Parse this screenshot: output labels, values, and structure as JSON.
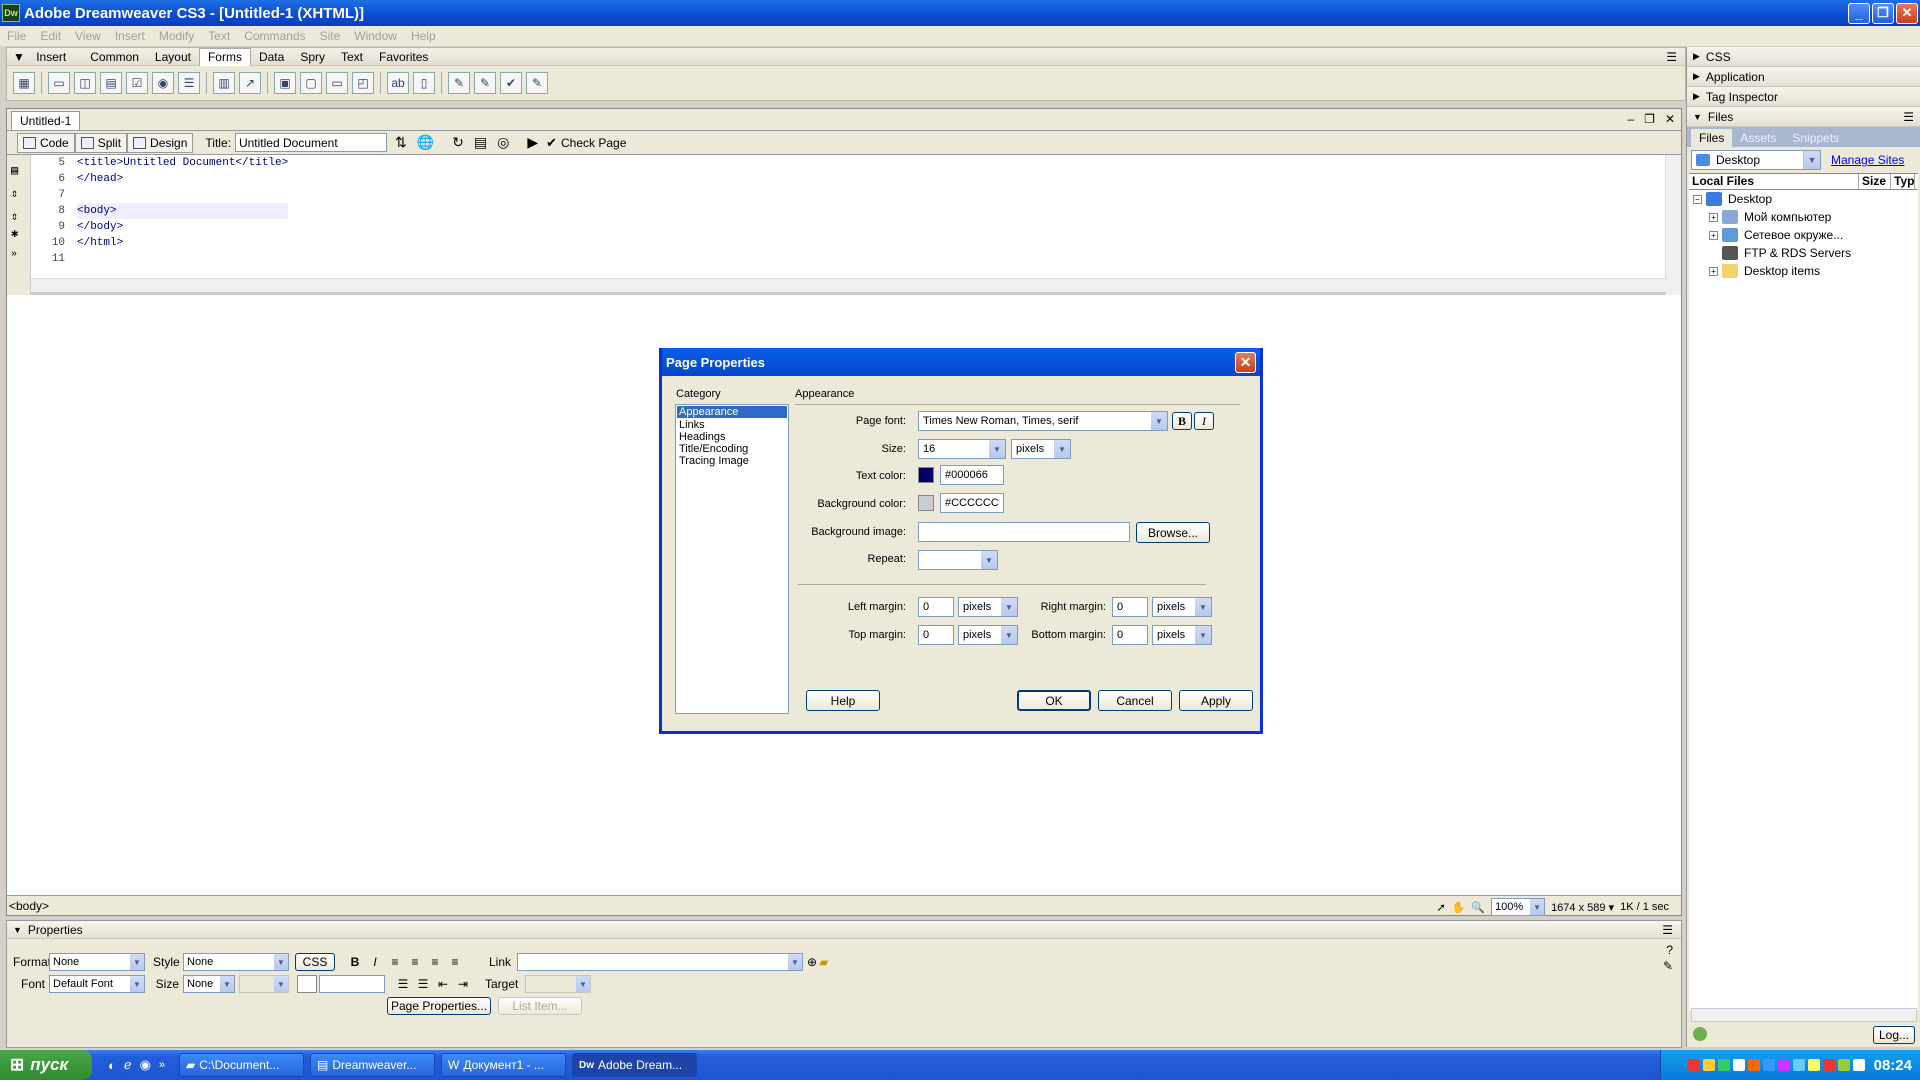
{
  "window": {
    "title": "Adobe Dreamweaver CS3 - [Untitled-1 (XHTML)]",
    "app_icon": "Dw"
  },
  "menubar": [
    "File",
    "Edit",
    "View",
    "Insert",
    "Modify",
    "Text",
    "Commands",
    "Site",
    "Window",
    "Help"
  ],
  "insert_bar": {
    "title": "Insert",
    "tabs": [
      "Common",
      "Layout",
      "Forms",
      "Data",
      "Spry",
      "Text",
      "Favorites"
    ],
    "active_tab": "Forms"
  },
  "right_panels": {
    "headers": [
      "CSS",
      "Application",
      "Tag Inspector",
      "Files"
    ],
    "files_tabs": [
      "Files",
      "Assets",
      "Snippets"
    ],
    "site_select": "Desktop",
    "manage_sites": "Manage Sites",
    "columns": [
      "Local Files",
      "Size",
      "Typ"
    ],
    "tree": [
      {
        "label": "Desktop",
        "level": 0,
        "expander": "−"
      },
      {
        "label": "Мой компьютер",
        "level": 1,
        "expander": "+"
      },
      {
        "label": "Сетевое окруже...",
        "level": 1,
        "expander": "+"
      },
      {
        "label": "FTP & RDS Servers",
        "level": 1,
        "expander": ""
      },
      {
        "label": "Desktop items",
        "level": 1,
        "expander": "+"
      }
    ],
    "log_button": "Log..."
  },
  "document": {
    "tab": "Untitled-1",
    "views": [
      "Code",
      "Split",
      "Design"
    ],
    "title_label": "Title:",
    "title_value": "Untitled Document",
    "check_page": "Check Page",
    "line_numbers": [
      "5",
      "6",
      "7",
      "8",
      "9",
      "10",
      "11"
    ],
    "code_lines": [
      "<title>Untitled Document</title>",
      "</head>",
      "",
      "<body>",
      "</body>",
      "</html>",
      ""
    ],
    "status_tag": "<body>",
    "zoom": "100%",
    "dimensions": "1674 x 589",
    "download": "1K / 1 sec"
  },
  "dialog": {
    "title": "Page Properties",
    "category_label": "Category",
    "categories": [
      "Appearance",
      "Links",
      "Headings",
      "Title/Encoding",
      "Tracing Image"
    ],
    "selected_category": "Appearance",
    "section_title": "Appearance",
    "page_font_label": "Page font:",
    "page_font": "Times New Roman, Times, serif",
    "bold": "B",
    "italic": "I",
    "size_label": "Size:",
    "size": "16",
    "size_unit": "pixels",
    "text_color_label": "Text color:",
    "text_color": "#000066",
    "bg_color_label": "Background color:",
    "bg_color": "#CCCCCC",
    "bg_image_label": "Background image:",
    "bg_image": "",
    "browse": "Browse...",
    "repeat_label": "Repeat:",
    "repeat": "",
    "left_margin_label": "Left margin:",
    "left_margin": "0",
    "right_margin_label": "Right margin:",
    "right_margin": "0",
    "top_margin_label": "Top margin:",
    "top_margin": "0",
    "bottom_margin_label": "Bottom margin:",
    "bottom_margin": "0",
    "margin_unit": "pixels",
    "buttons": {
      "help": "Help",
      "ok": "OK",
      "cancel": "Cancel",
      "apply": "Apply"
    }
  },
  "properties": {
    "title": "Properties",
    "format_label": "Format",
    "format": "None",
    "style_label": "Style",
    "style": "None",
    "css_btn": "CSS",
    "link_label": "Link",
    "font_label": "Font",
    "font": "Default Font",
    "size_label": "Size",
    "size": "None",
    "target_label": "Target",
    "page_props_btn": "Page Properties...",
    "list_item_btn": "List Item..."
  },
  "taskbar": {
    "start": "пуск",
    "tasks": [
      "C:\\Document...",
      "Dreamweaver...",
      "Документ1 - ...",
      "Adobe Dream..."
    ],
    "active_task": 3,
    "clock": "08:24"
  }
}
